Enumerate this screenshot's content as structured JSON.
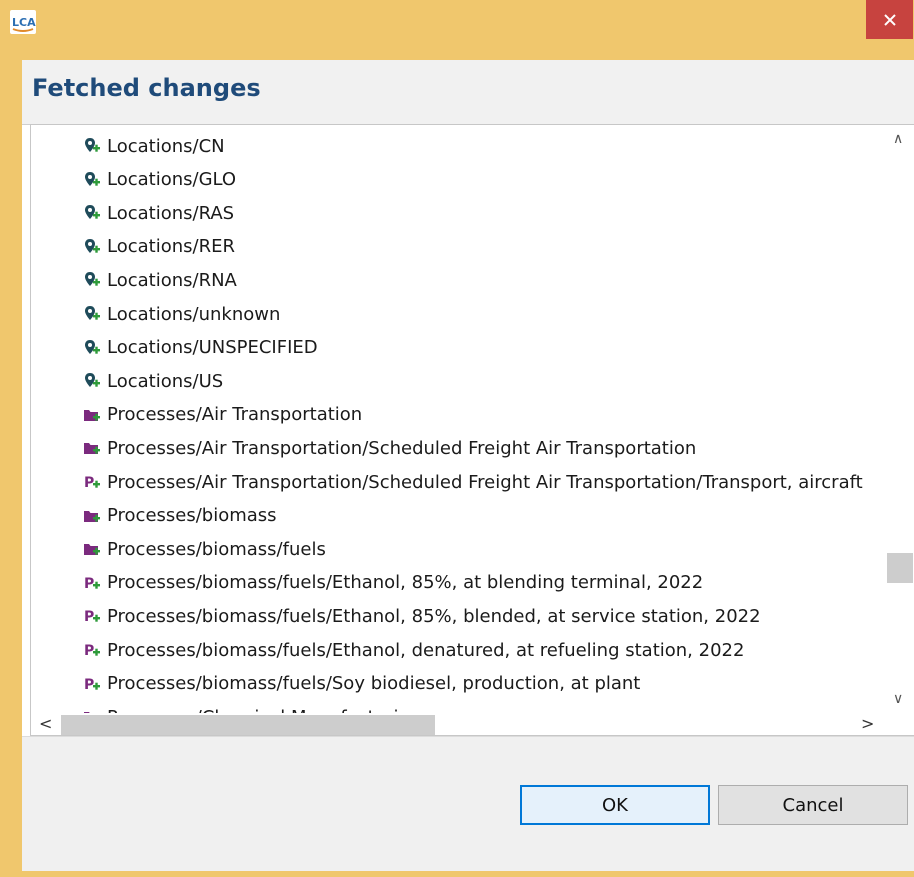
{
  "window": {
    "app_logo_text": "LCA",
    "close_label": "✕",
    "title": "Fetched changes"
  },
  "changes": [
    {
      "label": "Locations/CN",
      "icon": "location-pin-add-icon"
    },
    {
      "label": "Locations/GLO",
      "icon": "location-pin-add-icon"
    },
    {
      "label": "Locations/RAS",
      "icon": "location-pin-add-icon"
    },
    {
      "label": "Locations/RER",
      "icon": "location-pin-add-icon"
    },
    {
      "label": "Locations/RNA",
      "icon": "location-pin-add-icon"
    },
    {
      "label": "Locations/unknown",
      "icon": "location-pin-add-icon"
    },
    {
      "label": "Locations/UNSPECIFIED",
      "icon": "location-pin-add-icon"
    },
    {
      "label": "Locations/US",
      "icon": "location-pin-add-icon"
    },
    {
      "label": "Processes/Air Transportation",
      "icon": "folder-add-icon"
    },
    {
      "label": "Processes/Air Transportation/Scheduled Freight Air Transportation",
      "icon": "folder-add-icon"
    },
    {
      "label": "Processes/Air Transportation/Scheduled Freight Air Transportation/Transport, aircraft",
      "icon": "process-add-icon"
    },
    {
      "label": "Processes/biomass",
      "icon": "folder-add-icon"
    },
    {
      "label": "Processes/biomass/fuels",
      "icon": "folder-add-icon"
    },
    {
      "label": "Processes/biomass/fuels/Ethanol, 85%, at blending terminal, 2022",
      "icon": "process-add-icon"
    },
    {
      "label": "Processes/biomass/fuels/Ethanol, 85%, blended, at service station, 2022",
      "icon": "process-add-icon"
    },
    {
      "label": "Processes/biomass/fuels/Ethanol, denatured, at refueling station, 2022",
      "icon": "process-add-icon"
    },
    {
      "label": "Processes/biomass/fuels/Soy biodiesel, production, at plant",
      "icon": "process-add-icon"
    },
    {
      "label": "Processes/Chemical Manufacturing",
      "icon": "folder-add-icon"
    }
  ],
  "buttons": {
    "ok": "OK",
    "cancel": "Cancel"
  },
  "colors": {
    "window_frame": "#f0c76d",
    "close_button": "#c7433f",
    "title_text": "#1f4b7a",
    "location_icon": "#1f4b5a",
    "folder_icon": "#7b2a7e",
    "process_icon": "#7b2a7e",
    "add_badge": "#2e9a3a"
  }
}
